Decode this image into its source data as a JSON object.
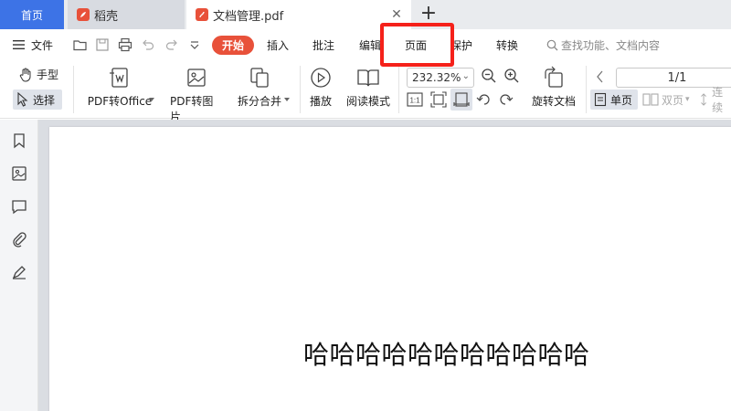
{
  "tabs": {
    "home": "首页",
    "daoke": "稻壳",
    "document": "文档管理.pdf"
  },
  "menu": {
    "file_label": "文件",
    "items": [
      "开始",
      "插入",
      "批注",
      "编辑",
      "页面",
      "保护",
      "转换"
    ],
    "search_placeholder": "查找功能、文档内容"
  },
  "ribbon": {
    "hand_tool": "手型",
    "select_tool": "选择",
    "pdf_to_office": "PDF转Office",
    "pdf_to_image": "PDF转图片",
    "split_merge": "拆分合并",
    "play": "播放",
    "reading_mode": "阅读模式",
    "zoom_value": "232.32%",
    "rotate_doc": "旋转文档",
    "page_indicator": "1/1",
    "single_page": "单页",
    "double_page": "双页",
    "continuous": "连续"
  },
  "document": {
    "content": "哈哈哈哈哈哈哈哈哈哈哈"
  },
  "colors": {
    "accent_blue": "#3d73e6",
    "start_tab_red": "#e8513a",
    "highlight_red": "#f5211a"
  }
}
